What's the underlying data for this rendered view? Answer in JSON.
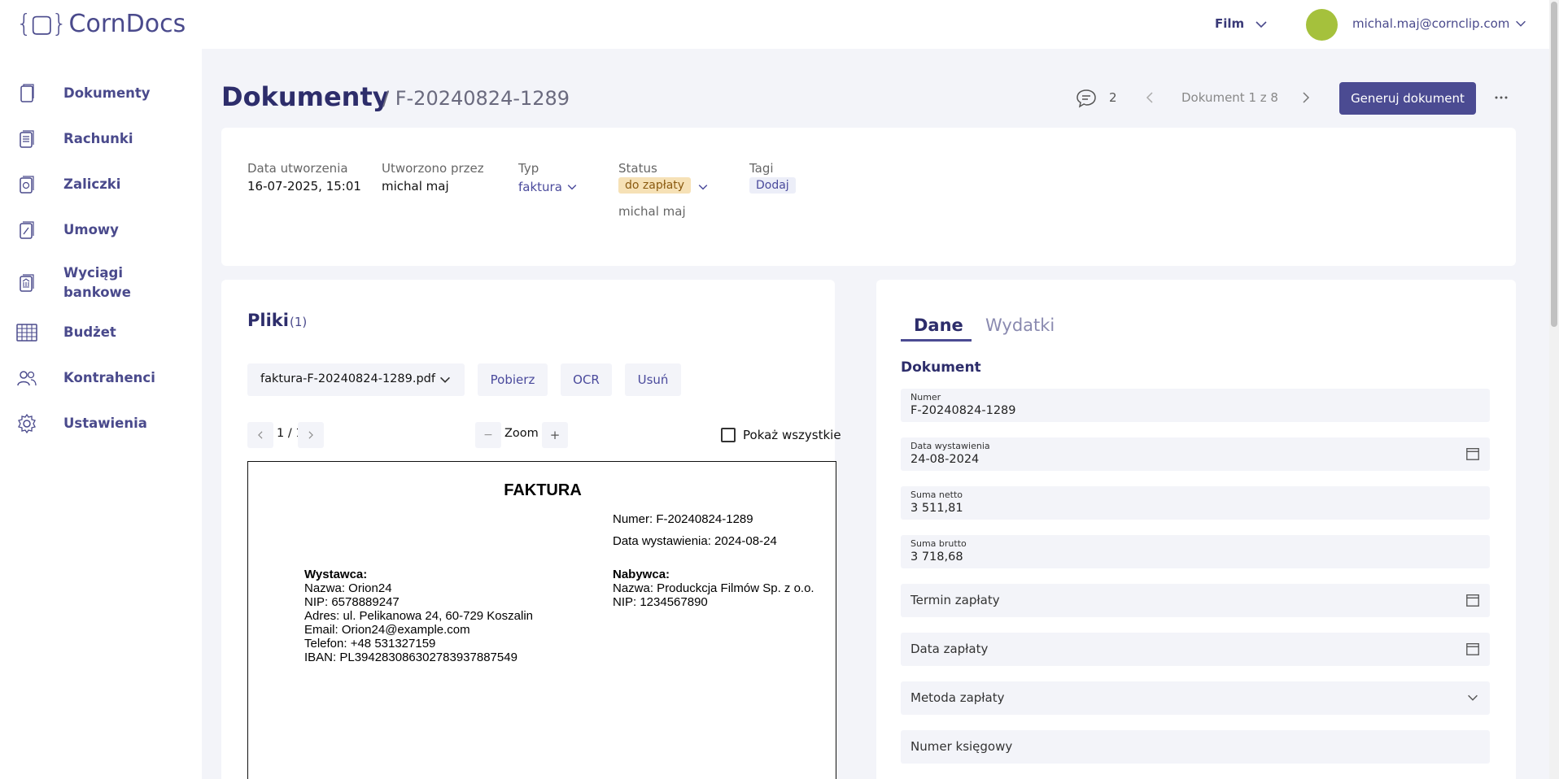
{
  "app": {
    "logo_mark": "{▢}",
    "name": "CornDocs"
  },
  "topbar": {
    "project": "Film",
    "user_email": "michal.maj@cornclip.com"
  },
  "sidebar": {
    "items": [
      {
        "label": "Dokumenty",
        "icon": "document-icon"
      },
      {
        "label": "Rachunki",
        "icon": "receipt-icon"
      },
      {
        "label": "Zaliczki",
        "icon": "advance-icon"
      },
      {
        "label": "Umowy",
        "icon": "contract-icon"
      },
      {
        "label": "Wyciągi bankowe",
        "icon": "bank-statement-icon"
      },
      {
        "label": "Budżet",
        "icon": "table-icon"
      },
      {
        "label": "Kontrahenci",
        "icon": "users-icon"
      },
      {
        "label": "Ustawienia",
        "icon": "gear-icon"
      }
    ]
  },
  "header": {
    "title": "Dokumenty",
    "subtitle": "/ F-20240824-1289",
    "comments_count": "2",
    "doc_counter": "Dokument 1 z 8",
    "generate_button": "Generuj dokument"
  },
  "info": {
    "created_label": "Data utworzenia",
    "created_value": "16-07-2025, 15:01",
    "created_by_label": "Utworzono przez",
    "created_by_value": "michal maj",
    "type_label": "Typ",
    "type_value": "faktura",
    "status_label": "Status",
    "status_value": "do zapłaty",
    "status_user": "michal maj",
    "tags_label": "Tagi",
    "tags_add": "Dodaj",
    "status_color": "#f6e1b6"
  },
  "files": {
    "title": "Pliki",
    "count": "(1)",
    "selected_file": "faktura-F-20240824-1289.pdf",
    "download": "Pobierz",
    "ocr": "OCR",
    "delete": "Usuń",
    "page_indicator": "1 / 1",
    "zoom_label": "Zoom",
    "zoom_out": "−",
    "zoom_in": "+",
    "show_all": "Pokaż wszystkie"
  },
  "pdf": {
    "title": "FAKTURA",
    "number": "Numer: F-20240824-1289",
    "issue_date": "Data wystawienia: 2024-08-24",
    "seller_heading": "Wystawca:",
    "seller_lines": [
      "Nazwa: Orion24",
      "NIP: 6578889247",
      "Adres: ul. Pelikanowa 24, 60-729 Koszalin",
      "Email: Orion24@example.com",
      "Telefon: +48 531327159",
      "IBAN: PL39428308630278393788754​9"
    ],
    "buyer_heading": "Nabywca:",
    "buyer_lines": [
      "Nazwa: Produckcja Filmów Sp. z o.o.",
      "NIP: 1234567890"
    ]
  },
  "data_panel": {
    "tab_data": "Dane",
    "tab_expenses": "Wydatki",
    "section": "Dokument",
    "number_label": "Numer",
    "number_value": "F-20240824-1289",
    "issue_label": "Data wystawienia",
    "issue_value": "24-08-2024",
    "net_label": "Suma netto",
    "net_value": "3 511,81",
    "gross_label": "Suma brutto",
    "gross_value": "3 718,68",
    "due_date": "Termin zapłaty",
    "payment_date": "Data zapłaty",
    "payment_method": "Metoda zapłaty",
    "accounting_number": "Numer księgowy"
  },
  "colors": {
    "primary": "#4b4b92",
    "heading": "#2d2d6b",
    "avatar": "#a5c13c"
  }
}
